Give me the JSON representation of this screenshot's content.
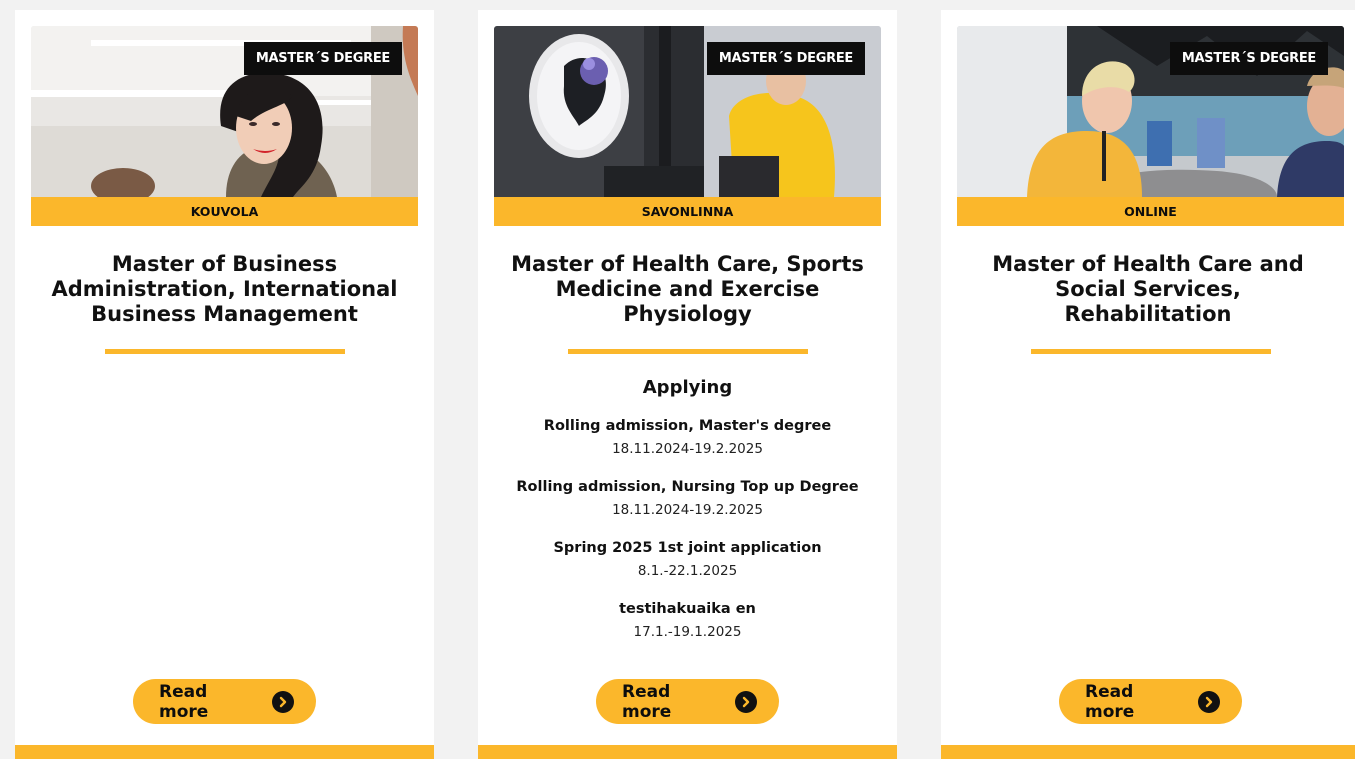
{
  "cards": [
    {
      "degree_tag": "MASTER´S DEGREE",
      "location": "KOUVOLA",
      "title": "Master of Business Administration, International Business Management",
      "read_more": "Read more"
    },
    {
      "degree_tag": "MASTER´S DEGREE",
      "location": "SAVONLINNA",
      "title": "Master of Health Care, Sports Medicine and Exercise Physiology",
      "applying": {
        "heading": "Applying",
        "periods": [
          {
            "name": "Rolling admission, Master's degree",
            "dates": "18.11.2024-19.2.2025"
          },
          {
            "name": "Rolling admission, Nursing Top up Degree",
            "dates": "18.11.2024-19.2.2025"
          },
          {
            "name": "Spring 2025 1st joint application",
            "dates": "8.1.-22.1.2025"
          },
          {
            "name": "testihakuaika en",
            "dates": "17.1.-19.1.2025"
          }
        ]
      },
      "read_more": "Read more"
    },
    {
      "degree_tag": "MASTER´S DEGREE",
      "location": "ONLINE",
      "title": "Master of Health Care and Social Services, Rehabilitation",
      "read_more": "Read more"
    }
  ],
  "colors": {
    "accent": "#fbb72b",
    "tag_bg": "#0d0d0d",
    "page_bg": "#f2f2f2",
    "card_bg": "#ffffff"
  },
  "icons": {
    "read_more": "arrow-right-circle-icon"
  }
}
